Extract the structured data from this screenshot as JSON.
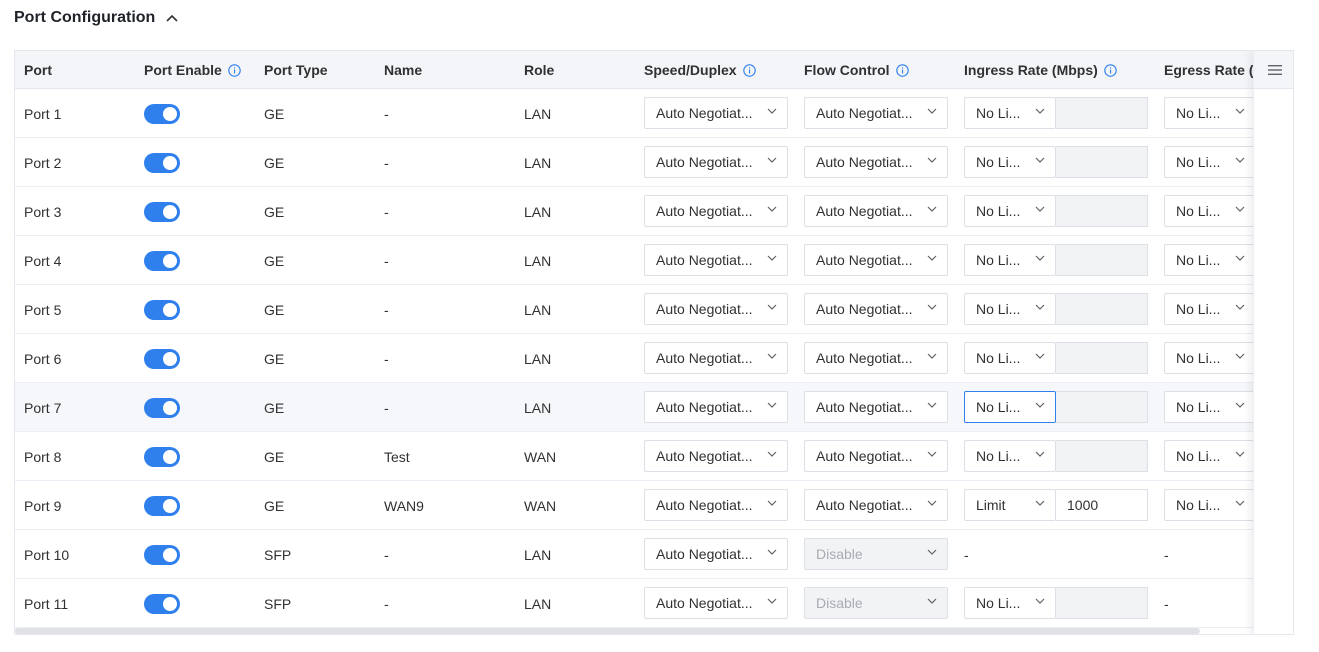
{
  "section": {
    "title": "Port Configuration",
    "collapse_icon": "chevron-up-icon"
  },
  "columns": {
    "port": "Port",
    "port_enable": "Port Enable",
    "port_type": "Port Type",
    "name": "Name",
    "role": "Role",
    "speed_duplex": "Speed/Duplex",
    "flow_control": "Flow Control",
    "ingress_rate": "Ingress Rate (Mbps)",
    "egress_rate": "Egress Rate ("
  },
  "rows": [
    {
      "port": "Port 1",
      "enabled": true,
      "type": "GE",
      "name": "-",
      "role": "LAN",
      "speed": "Auto Negotiat...",
      "flow": "Auto Negotiat...",
      "flow_disabled": false,
      "ingress": "No Li...",
      "ingress_value": "",
      "ingress_dash": "",
      "egress": "No Li...",
      "egress_dash": ""
    },
    {
      "port": "Port 2",
      "enabled": true,
      "type": "GE",
      "name": "-",
      "role": "LAN",
      "speed": "Auto Negotiat...",
      "flow": "Auto Negotiat...",
      "flow_disabled": false,
      "ingress": "No Li...",
      "ingress_value": "",
      "ingress_dash": "",
      "egress": "No Li...",
      "egress_dash": ""
    },
    {
      "port": "Port 3",
      "enabled": true,
      "type": "GE",
      "name": "-",
      "role": "LAN",
      "speed": "Auto Negotiat...",
      "flow": "Auto Negotiat...",
      "flow_disabled": false,
      "ingress": "No Li...",
      "ingress_value": "",
      "ingress_dash": "",
      "egress": "No Li...",
      "egress_dash": ""
    },
    {
      "port": "Port 4",
      "enabled": true,
      "type": "GE",
      "name": "-",
      "role": "LAN",
      "speed": "Auto Negotiat...",
      "flow": "Auto Negotiat...",
      "flow_disabled": false,
      "ingress": "No Li...",
      "ingress_value": "",
      "ingress_dash": "",
      "egress": "No Li...",
      "egress_dash": ""
    },
    {
      "port": "Port 5",
      "enabled": true,
      "type": "GE",
      "name": "-",
      "role": "LAN",
      "speed": "Auto Negotiat...",
      "flow": "Auto Negotiat...",
      "flow_disabled": false,
      "ingress": "No Li...",
      "ingress_value": "",
      "ingress_dash": "",
      "egress": "No Li...",
      "egress_dash": ""
    },
    {
      "port": "Port 6",
      "enabled": true,
      "type": "GE",
      "name": "-",
      "role": "LAN",
      "speed": "Auto Negotiat...",
      "flow": "Auto Negotiat...",
      "flow_disabled": false,
      "ingress": "No Li...",
      "ingress_value": "",
      "ingress_dash": "",
      "egress": "No Li...",
      "egress_dash": ""
    },
    {
      "port": "Port 7",
      "enabled": true,
      "type": "GE",
      "name": "-",
      "role": "LAN",
      "speed": "Auto Negotiat...",
      "flow": "Auto Negotiat...",
      "flow_disabled": false,
      "ingress": "No Li...",
      "ingress_value": "",
      "ingress_dash": "",
      "egress": "No Li...",
      "egress_dash": "",
      "hover": true,
      "ingress_focus": true
    },
    {
      "port": "Port 8",
      "enabled": true,
      "type": "GE",
      "name": "Test",
      "role": "WAN",
      "speed": "Auto Negotiat...",
      "flow": "Auto Negotiat...",
      "flow_disabled": false,
      "ingress": "No Li...",
      "ingress_value": "",
      "ingress_dash": "",
      "egress": "No Li...",
      "egress_dash": ""
    },
    {
      "port": "Port 9",
      "enabled": true,
      "type": "GE",
      "name": "WAN9",
      "role": "WAN",
      "speed": "Auto Negotiat...",
      "flow": "Auto Negotiat...",
      "flow_disabled": false,
      "ingress": "Limit",
      "ingress_value": "1000",
      "ingress_dash": "",
      "egress": "No Li...",
      "egress_dash": ""
    },
    {
      "port": "Port 10",
      "enabled": true,
      "type": "SFP",
      "name": "-",
      "role": "LAN",
      "speed": "Auto Negotiat...",
      "flow": "Disable",
      "flow_disabled": true,
      "ingress": "",
      "ingress_value": "",
      "ingress_dash": "-",
      "egress": "",
      "egress_dash": "-"
    },
    {
      "port": "Port 11",
      "enabled": true,
      "type": "SFP",
      "name": "-",
      "role": "LAN",
      "speed": "Auto Negotiat...",
      "flow": "Disable",
      "flow_disabled": true,
      "ingress": "No Li...",
      "ingress_value": "",
      "ingress_dash": "",
      "egress": "",
      "egress_dash": "-"
    }
  ],
  "colors": {
    "accent": "#2f80ed",
    "header_bg": "#f3f5f8",
    "hover_bg": "#f5f7fa",
    "disabled_bg": "#f2f3f5"
  },
  "table_menu_icon": "hamburger-menu-icon"
}
